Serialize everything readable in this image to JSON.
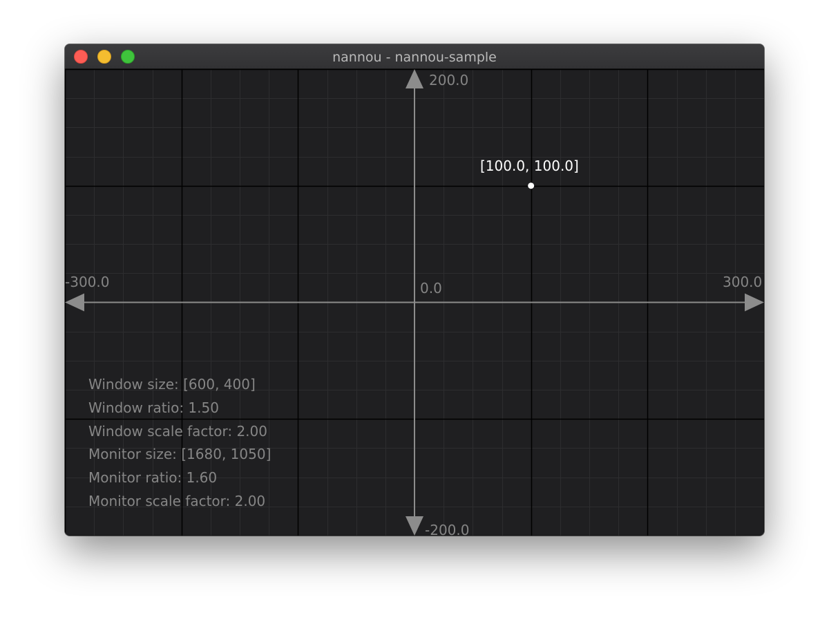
{
  "window": {
    "title": "nannou - nannou-sample"
  },
  "axes": {
    "y_max_label": "200.0",
    "y_min_label": "-200.0",
    "x_min_label": "-300.0",
    "x_max_label": "300.0",
    "origin_label": "0.0",
    "x_range": [
      -300,
      300
    ],
    "y_range": [
      -200,
      200
    ],
    "grid_minor_step": 25,
    "grid_major_step": 100
  },
  "point": {
    "x": 100,
    "y": 100,
    "label": "[100.0, 100.0]"
  },
  "info": {
    "window_size": "Window size: [600, 400]",
    "window_ratio": "Window ratio: 1.50",
    "window_scale": "Window scale factor: 2.00",
    "monitor_size": "Monitor size: [1680, 1050]",
    "monitor_ratio": "Monitor ratio: 1.60",
    "monitor_scale": "Monitor scale factor: 2.00"
  },
  "colors": {
    "background": "#1f1f21",
    "grid_minor": "#2d2d2f",
    "grid_major": "#000000",
    "axis": "#8c8c8c",
    "point": "#ffffff",
    "close": "#fd5d55",
    "minimize": "#f4bd30",
    "maximize": "#3fc33c"
  }
}
